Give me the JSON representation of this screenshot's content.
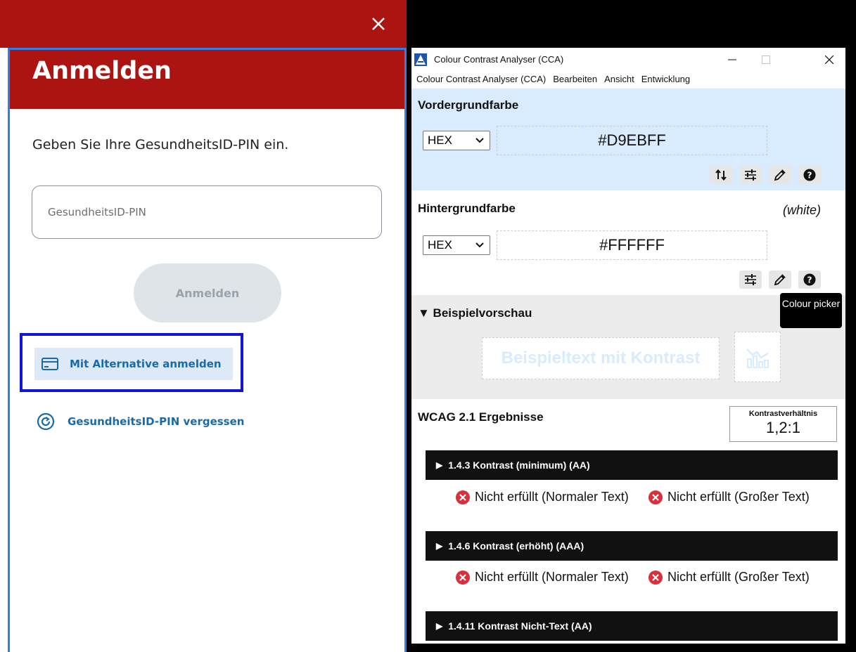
{
  "dialog": {
    "title": "Anmelden",
    "instruction": "Geben Sie Ihre GesundheitsID-PIN ein.",
    "pin_placeholder": "GesundheitsID-PIN",
    "pin_value": "",
    "login_button": "Anmelden",
    "alt_login_link": "Mit Alternative anmelden",
    "forgot_pin_link": "GesundheitsID-PIN vergessen",
    "colors": {
      "brand_red": "#ab1410",
      "link_blue": "#1b6aa8",
      "highlight_blue": "#1016d6"
    }
  },
  "cca": {
    "window_title": "Colour Contrast Analyser (CCA)",
    "menu": [
      "Colour Contrast Analyser (CCA)",
      "Bearbeiten",
      "Ansicht",
      "Entwicklung"
    ],
    "foreground": {
      "title": "Vordergrundfarbe",
      "format": "HEX",
      "value": "#D9EBFF",
      "color": "#D9EBFF"
    },
    "background": {
      "title": "Hintergrundfarbe",
      "color_name": "(white)",
      "format": "HEX",
      "value": "#FFFFFF",
      "color": "#FFFFFF"
    },
    "tooltip": "Colour picker",
    "preview": {
      "title": "▼ Beispielvorschau",
      "sample_text": "Beispieltext mit Kontrast"
    },
    "results": {
      "title": "WCAG 2.1 Ergebnisse",
      "ratio_label": "Kontrastverhältnis",
      "ratio_value": "1,2:1",
      "criteria": [
        {
          "label": "1.4.3 Kontrast (minimum) (AA)",
          "normal_text": "Nicht erfüllt (Normaler Text)",
          "large_text": "Nicht erfüllt (Großer Text)"
        },
        {
          "label": "1.4.6 Kontrast (erhöht) (AAA)",
          "normal_text": "Nicht erfüllt (Normaler Text)",
          "large_text": "Nicht erfüllt (Großer Text)"
        },
        {
          "label": "1.4.11 Kontrast Nicht-Text (AA)"
        }
      ]
    },
    "icons": {
      "swap": "swap-arrows-icon",
      "sliders": "sliders-icon",
      "eyedropper": "eyedropper-icon",
      "help": "help-circle-icon",
      "fail": "fail-x-icon",
      "chart_preview": "chart-icon"
    }
  }
}
